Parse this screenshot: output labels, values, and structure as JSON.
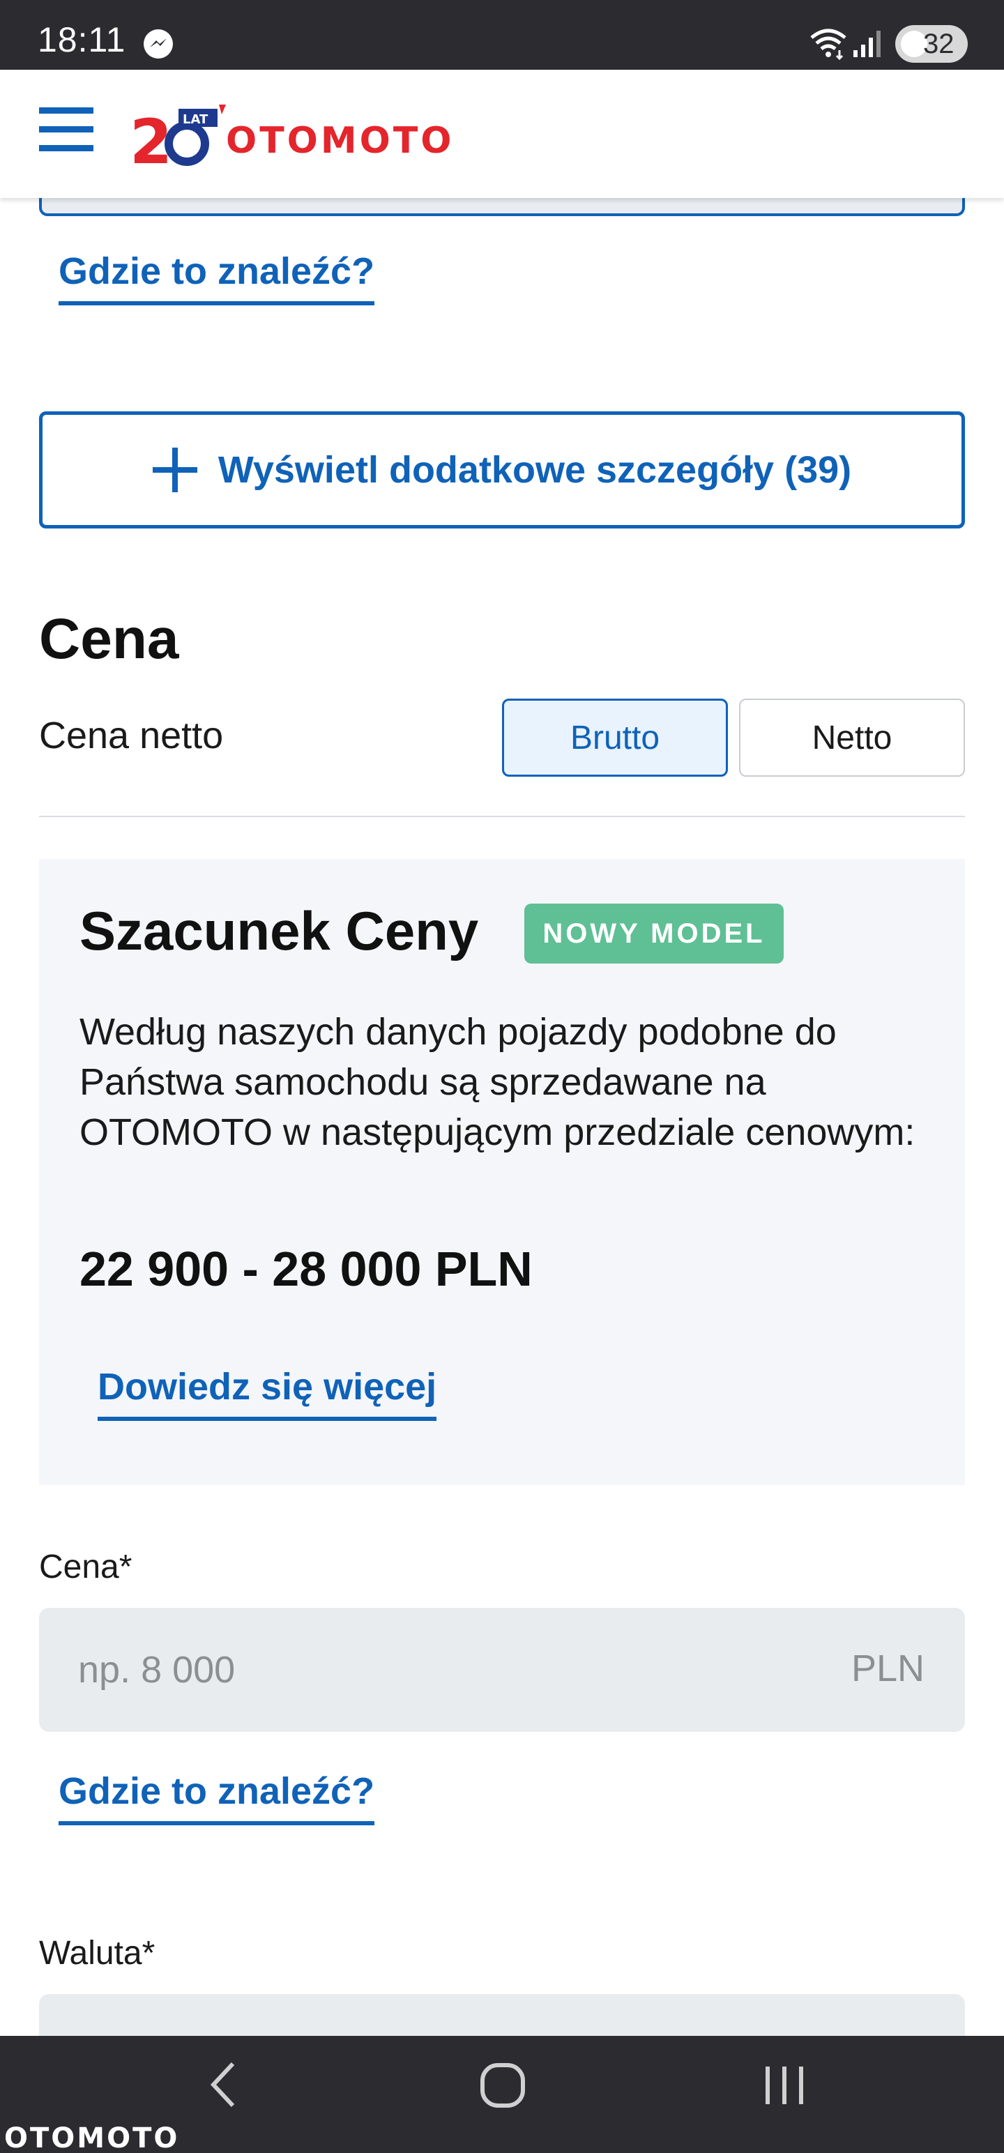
{
  "status_bar": {
    "time": "18:11",
    "battery": "32",
    "icons": [
      "messenger-icon",
      "wifi-icon",
      "signal-icon",
      "battery-icon"
    ]
  },
  "header": {
    "logo_badge_number": "20",
    "logo_badge_small": "LAT",
    "logo_text": "OTOMOTO",
    "brand_colors": {
      "red": "#e4252c",
      "blue": "#1e3a8f"
    }
  },
  "top_section": {
    "where_link": "Gdzie to znaleźć?"
  },
  "details_button": {
    "label": "Wyświetl dodatkowe szczegóły (39)",
    "icon": "plus-icon"
  },
  "price_section": {
    "title": "Cena",
    "net_price_label": "Cena netto",
    "toggle": {
      "options": [
        "Brutto",
        "Netto"
      ],
      "selected": "Brutto"
    }
  },
  "estimate": {
    "title": "Szacunek Ceny",
    "badge": "NOWY MODEL",
    "description": "Według naszych danych pojazdy podobne do Państwa samochodu są sprzedawane na OTOMOTO w następującym przedziale cenowym:",
    "range": "22 900 - 28 000 PLN",
    "learn_more": "Dowiedz się więcej"
  },
  "price_field": {
    "label": "Cena*",
    "placeholder": "np. 8 000",
    "value": "",
    "suffix": "PLN",
    "where_link": "Gdzie to znaleźć?"
  },
  "currency_field": {
    "label": "Waluta*"
  },
  "nav_bar": {
    "icons": [
      "back-icon",
      "home-icon",
      "recents-icon"
    ],
    "watermark": "OTOMOTO"
  },
  "colors": {
    "accent": "#0f62b8",
    "badge_green": "#5fbf95",
    "card_bg": "#f4f6f9",
    "input_bg": "#e9ecef",
    "system_bar": "#2b2b30"
  }
}
